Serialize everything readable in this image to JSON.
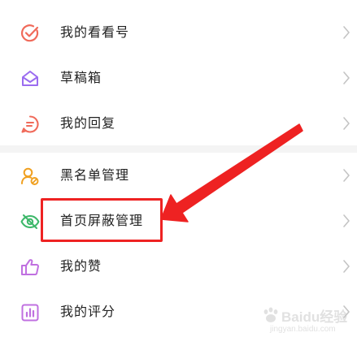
{
  "menu": {
    "items": [
      {
        "label": "我的看看号",
        "icon": "check-circle-icon",
        "icon_color": "#f06a5a"
      },
      {
        "label": "草稿箱",
        "icon": "envelope-open-icon",
        "icon_color": "#9b6cf0"
      },
      {
        "label": "我的回复",
        "icon": "chat-bubble-icon",
        "icon_color": "#f06a5a"
      },
      {
        "label": "黑名单管理",
        "icon": "person-blocked-icon",
        "icon_color": "#f0a020"
      },
      {
        "label": "首页屏蔽管理",
        "icon": "eye-off-icon",
        "icon_color": "#3db86a"
      },
      {
        "label": "我的赞",
        "icon": "thumbs-up-icon",
        "icon_color": "#c070e0"
      },
      {
        "label": "我的评分",
        "icon": "bar-chart-icon",
        "icon_color": "#c070e0"
      }
    ]
  },
  "annotation": {
    "color": "#ee2222",
    "highlighted_item": "首页屏蔽管理"
  },
  "watermark": {
    "brand": "Baidu经验",
    "url": "jingyan.baidu.com"
  },
  "colors": {
    "chevron": "#c4c4c4",
    "divider": "#f4f4f4",
    "text": "#222222"
  }
}
